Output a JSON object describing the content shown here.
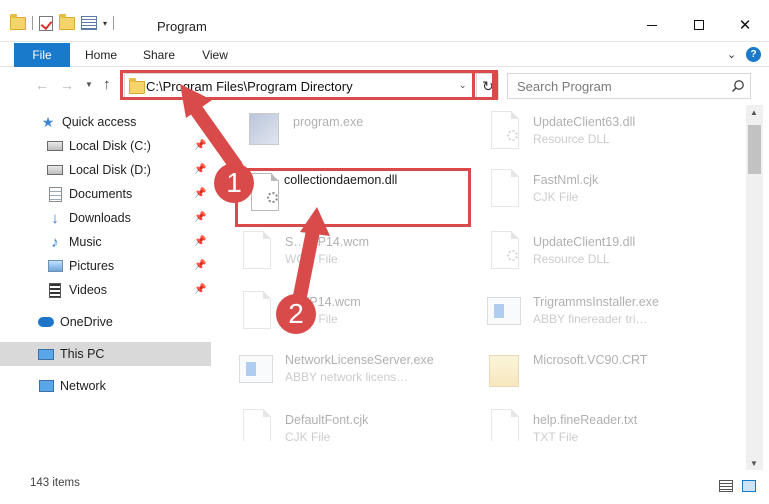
{
  "window": {
    "title": "Program",
    "minimize_glyph": "—",
    "close_glyph": "✕"
  },
  "ribbon": {
    "tabs": [
      {
        "label": "File"
      },
      {
        "label": "Home"
      },
      {
        "label": "Share"
      },
      {
        "label": "View"
      }
    ],
    "help_glyph": "?"
  },
  "navigation": {
    "address": "C:\\Program Files\\Program Directory",
    "search_placeholder": "Search Program"
  },
  "sidebar": {
    "items": [
      {
        "label": "Quick access",
        "icon": "star-icon"
      },
      {
        "label": "Local Disk (C:)",
        "icon": "drive-icon",
        "pinned": true
      },
      {
        "label": "Local Disk (D:)",
        "icon": "drive-icon",
        "pinned": true
      },
      {
        "label": "Documents",
        "icon": "documents-icon",
        "pinned": true
      },
      {
        "label": "Downloads",
        "icon": "download-icon",
        "pinned": true
      },
      {
        "label": "Music",
        "icon": "music-icon",
        "pinned": true
      },
      {
        "label": "Pictures",
        "icon": "pictures-icon",
        "pinned": true
      },
      {
        "label": "Videos",
        "icon": "videos-icon",
        "pinned": true
      },
      {
        "label": "OneDrive",
        "icon": "cloud-icon"
      },
      {
        "label": "This PC",
        "icon": "computer-icon",
        "selected": true
      },
      {
        "label": "Network",
        "icon": "network-icon"
      }
    ]
  },
  "files": [
    {
      "name": "program.exe",
      "type": "",
      "icon": "exe-icon",
      "faded": true
    },
    {
      "name": "UpdateClient63.dll",
      "type": "Resource DLL",
      "icon": "dll-icon",
      "faded": true
    },
    {
      "name": "collectiondaemon.dll",
      "type": "",
      "icon": "dll-icon",
      "faded": false
    },
    {
      "name": "FastNml.cjk",
      "type": "CJK File",
      "icon": "file-icon",
      "faded": true
    },
    {
      "name": "S…WP14.wcm",
      "type": "WCM File",
      "icon": "file-icon",
      "faded": true
    },
    {
      "name": "UpdateClient19.dll",
      "type": "Resource DLL",
      "icon": "dll-icon",
      "faded": true
    },
    {
      "name": "…WP14.wcm",
      "type": "WCM File",
      "icon": "file-icon",
      "faded": true
    },
    {
      "name": "TrigrammsInstaller.exe",
      "type": "ABBY finereader tri…",
      "icon": "app-icon",
      "faded": true
    },
    {
      "name": "NetworkLicenseServer.exe",
      "type": "ABBY network licens…",
      "icon": "app-icon",
      "faded": true
    },
    {
      "name": "Microsoft.VC90.CRT",
      "type": "",
      "icon": "folder-icon",
      "faded": true
    },
    {
      "name": "DefaultFont.cjk",
      "type": "CJK File",
      "icon": "file-icon",
      "faded": true
    },
    {
      "name": "help.fineReader.txt",
      "type": "TXT File",
      "icon": "file-icon",
      "faded": true
    }
  ],
  "status": {
    "item_count": "143 items"
  },
  "annotations": {
    "badge1": "1",
    "badge2": "2",
    "arrow_color": "#d94a4a"
  }
}
